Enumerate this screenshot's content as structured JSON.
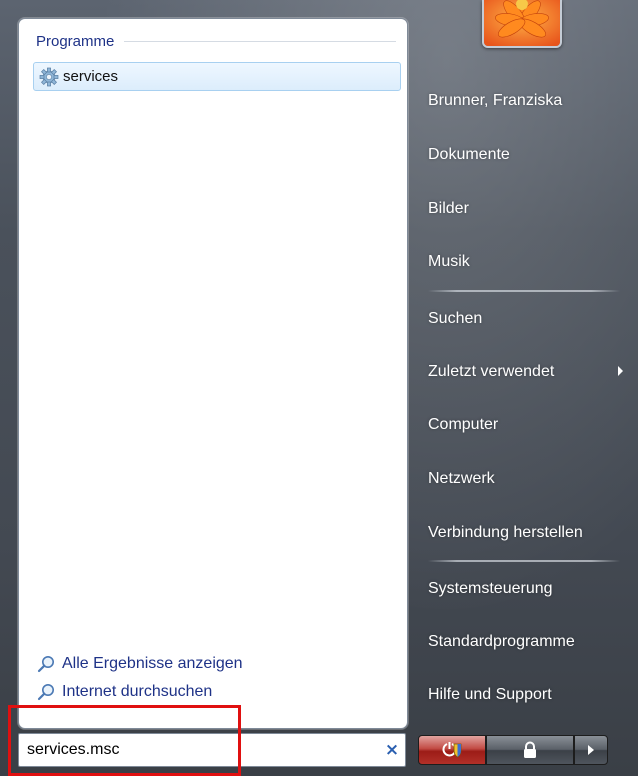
{
  "left_panel": {
    "section_title": "Programme",
    "result": {
      "label": "services",
      "icon": "services-gear-icon"
    },
    "links": {
      "show_all": "Alle Ergebnisse anzeigen",
      "search_internet": "Internet durchsuchen"
    }
  },
  "search": {
    "value": "services.msc",
    "clear_glyph": "×"
  },
  "user": {
    "picture_icon": "flower-user-picture"
  },
  "right_menu": {
    "user_name": "Brunner, Franziska",
    "items": [
      "Dokumente",
      "Bilder",
      "Musik",
      "Suchen",
      "Zuletzt verwendet",
      "Computer",
      "Netzwerk",
      "Verbindung herstellen",
      "Systemsteuerung",
      "Standardprogramme",
      "Hilfe und Support"
    ]
  },
  "power": {
    "shield_icon": "power-shield-icon",
    "lock_icon": "lock-icon",
    "arrow_icon": "arrow-right-icon"
  },
  "colors": {
    "link_blue": "#1e3287",
    "highlight_red": "#e01010",
    "panel_dark": "#4a515b"
  }
}
